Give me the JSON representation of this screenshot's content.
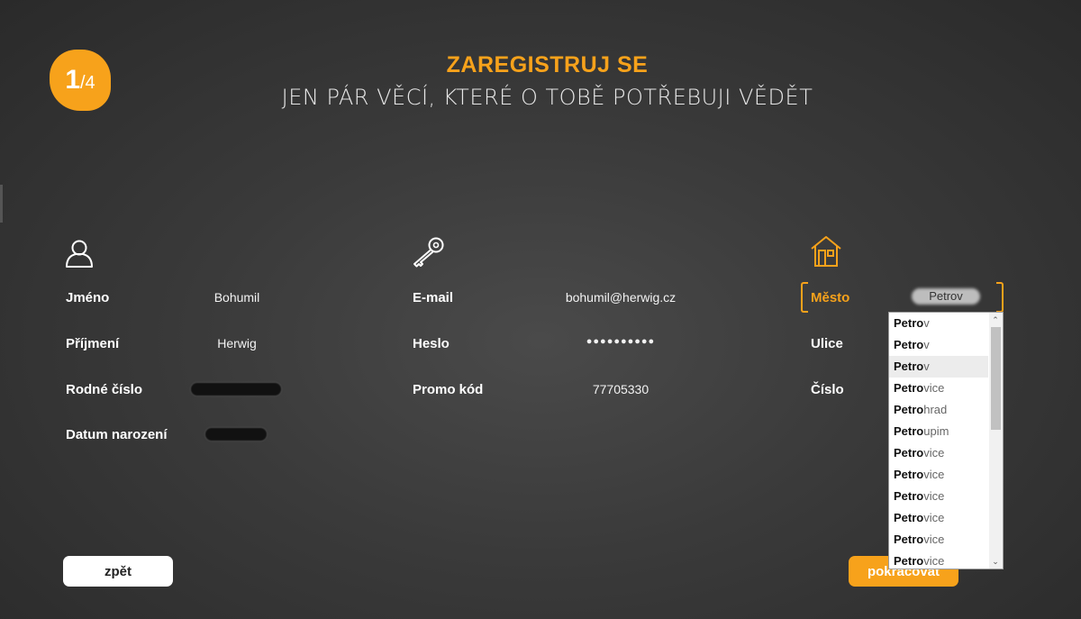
{
  "header": {
    "step_current": "1",
    "step_total": "/4",
    "title": "ZAREGISTRUJ SE",
    "subtitle": "JEN PÁR VĚCÍ, KTERÉ O TOBĚ POTŘEBUJI VĚDĚT"
  },
  "personal": {
    "icon": "user-icon",
    "fields": [
      {
        "label": "Jméno",
        "value": "Bohumil"
      },
      {
        "label": "Příjmení",
        "value": "Herwig"
      },
      {
        "label": "Rodné číslo",
        "value": ""
      },
      {
        "label": "Datum narození",
        "value": ""
      }
    ]
  },
  "account": {
    "icon": "key-icon",
    "fields": [
      {
        "label": "E-mail",
        "value": "bohumil@herwig.cz"
      },
      {
        "label": "Heslo",
        "value": "●●●●●●●●●●"
      },
      {
        "label": "Promo kód",
        "value": "77705330"
      }
    ]
  },
  "address": {
    "icon": "house-icon",
    "fields": [
      {
        "label": "Město",
        "value": "Petrov"
      },
      {
        "label": "Ulice",
        "value": ""
      },
      {
        "label": "Číslo",
        "value": ""
      }
    ],
    "autocomplete": [
      {
        "typed": "Petro",
        "rest": "v"
      },
      {
        "typed": "Petro",
        "rest": "v"
      },
      {
        "typed": "Petro",
        "rest": "v"
      },
      {
        "typed": "Petro",
        "rest": "vice"
      },
      {
        "typed": "Petro",
        "rest": "hrad"
      },
      {
        "typed": "Petro",
        "rest": "upim"
      },
      {
        "typed": "Petro",
        "rest": "vice"
      },
      {
        "typed": "Petro",
        "rest": "vice"
      },
      {
        "typed": "Petro",
        "rest": "vice"
      },
      {
        "typed": "Petro",
        "rest": "vice"
      },
      {
        "typed": "Petro",
        "rest": "vice"
      },
      {
        "typed": "Petro",
        "rest": "vice"
      }
    ]
  },
  "buttons": {
    "back": "zpět",
    "next": "pokračovat"
  },
  "colors": {
    "accent": "#f7a21b",
    "background": "#3a3a3a"
  }
}
